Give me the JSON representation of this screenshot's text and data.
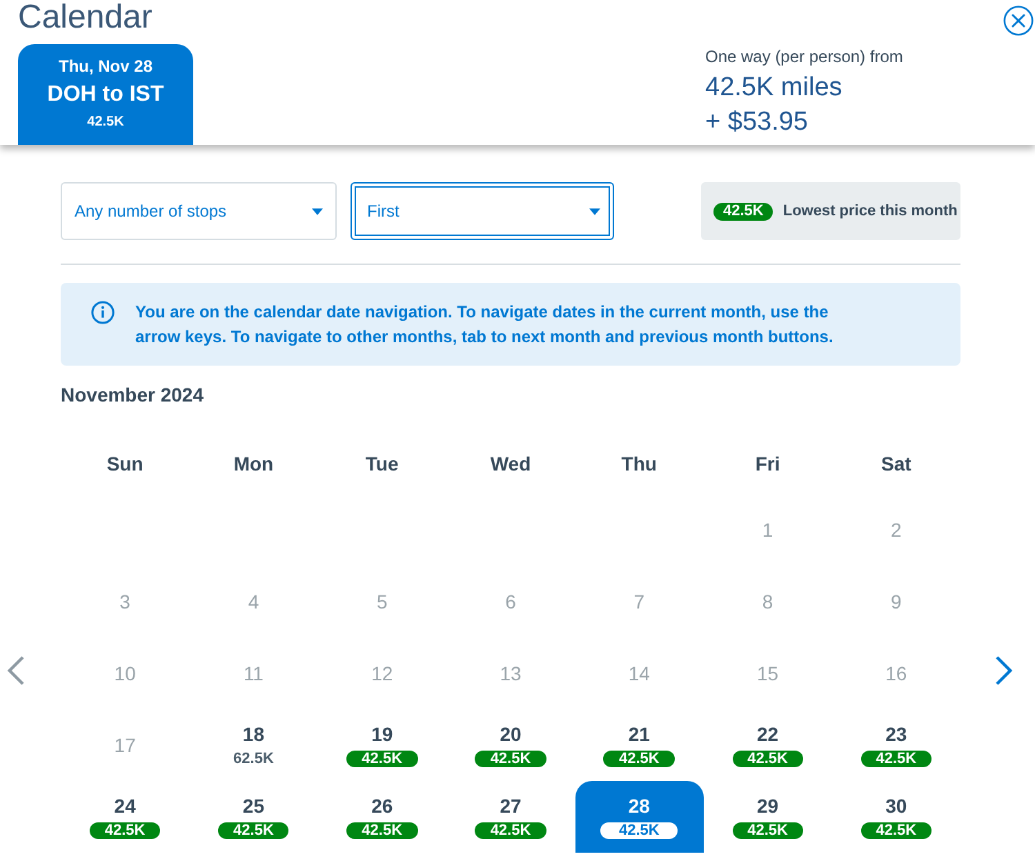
{
  "header": {
    "title": "Calendar",
    "selected_flight": {
      "date": "Thu, Nov 28",
      "route": "DOH to IST",
      "price": "42.5K"
    },
    "fare": {
      "label": "One way (per person) from",
      "miles": "42.5K miles",
      "cash": "+ $53.95"
    }
  },
  "filters": [
    {
      "value": "Any number of stops",
      "focused": false
    },
    {
      "value": "First",
      "focused": true
    }
  ],
  "legend": {
    "badge": "42.5K",
    "label": "Lowest price this month"
  },
  "info": {
    "text": "You are on the calendar date navigation. To navigate dates in the current month, use the arrow keys. To navigate to other months, tab to next month and previous month buttons."
  },
  "nav": {
    "previous": {
      "disabled": true
    },
    "next": {
      "disabled": false
    }
  },
  "month": {
    "title": "November 2024",
    "weekdays": [
      "Sun",
      "Mon",
      "Tue",
      "Wed",
      "Thu",
      "Fri",
      "Sat"
    ],
    "weeks": [
      [
        {
          "day": "1",
          "selected": false,
          "disabled": true
        },
        {
          "day": "2",
          "selected": false,
          "disabled": true
        }
      ],
      [
        {
          "day": "3",
          "selected": false,
          "disabled": true
        },
        {
          "day": "4",
          "selected": false,
          "disabled": true
        },
        {
          "day": "5",
          "selected": false,
          "disabled": true
        },
        {
          "day": "6",
          "selected": false,
          "disabled": true
        },
        {
          "day": "7",
          "selected": false,
          "disabled": true
        },
        {
          "day": "8",
          "selected": false,
          "disabled": true
        },
        {
          "day": "9",
          "selected": false,
          "disabled": true
        }
      ],
      [
        {
          "day": "10",
          "selected": false,
          "disabled": true
        },
        {
          "day": "11",
          "selected": false,
          "disabled": true
        },
        {
          "day": "12",
          "selected": false,
          "disabled": true
        },
        {
          "day": "13",
          "selected": false,
          "disabled": true
        },
        {
          "day": "14",
          "selected": false,
          "disabled": true
        },
        {
          "day": "15",
          "selected": false,
          "disabled": true
        },
        {
          "day": "16",
          "selected": false,
          "disabled": true
        }
      ],
      [
        {
          "day": "17",
          "selected": false,
          "disabled": true
        },
        {
          "day": "18",
          "selected": false,
          "disabled": false,
          "price": "62.5K",
          "lowest": false
        },
        {
          "day": "19",
          "selected": false,
          "disabled": false,
          "price": "42.5K",
          "lowest": true
        },
        {
          "day": "20",
          "selected": false,
          "disabled": false,
          "price": "42.5K",
          "lowest": true
        },
        {
          "day": "21",
          "selected": false,
          "disabled": false,
          "price": "42.5K",
          "lowest": true
        },
        {
          "day": "22",
          "selected": false,
          "disabled": false,
          "price": "42.5K",
          "lowest": true
        },
        {
          "day": "23",
          "selected": false,
          "disabled": false,
          "price": "42.5K",
          "lowest": true
        }
      ],
      [
        {
          "day": "24",
          "selected": false,
          "disabled": false,
          "price": "42.5K",
          "lowest": true
        },
        {
          "day": "25",
          "selected": false,
          "disabled": false,
          "price": "42.5K",
          "lowest": true
        },
        {
          "day": "26",
          "selected": false,
          "disabled": false,
          "price": "42.5K",
          "lowest": true
        },
        {
          "day": "27",
          "selected": false,
          "disabled": false,
          "price": "42.5K",
          "lowest": true
        },
        {
          "day": "28",
          "selected": true,
          "disabled": false,
          "price": "42.5K",
          "lowest": true
        },
        {
          "day": "29",
          "selected": false,
          "disabled": false,
          "price": "42.5K",
          "lowest": true
        },
        {
          "day": "30",
          "selected": false,
          "disabled": false,
          "price": "42.5K",
          "lowest": true
        }
      ]
    ]
  }
}
